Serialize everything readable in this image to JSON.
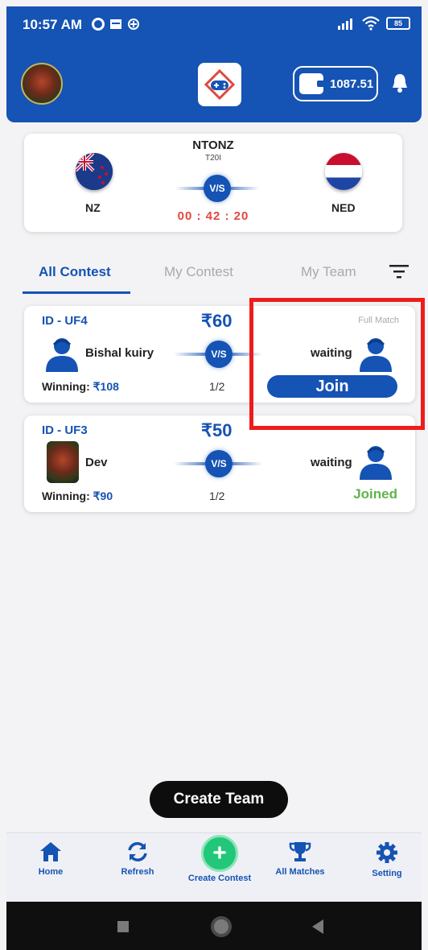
{
  "status_bar": {
    "time": "10:57 AM",
    "battery": "85"
  },
  "header": {
    "wallet_amount": "1087.51"
  },
  "match": {
    "title": "NTONZ",
    "format": "T20I",
    "team_left": "NZ",
    "team_right": "NED",
    "vs_label": "V/S",
    "countdown": "00 : 42 : 20"
  },
  "tabs": [
    {
      "label": "All Contest",
      "active": true
    },
    {
      "label": "My Contest",
      "active": false
    },
    {
      "label": "My Team",
      "active": false
    }
  ],
  "contests": [
    {
      "id": "ID - UF4",
      "fee": "₹60",
      "tag": "Full Match",
      "player": "Bishal kuiry",
      "vs_label": "V/S",
      "opponent": "waiting",
      "winning_label": "Winning:",
      "winning_value": "₹108",
      "slots": "1/2",
      "action": "Join"
    },
    {
      "id": "ID - UF3",
      "fee": "₹50",
      "player": "Dev",
      "vs_label": "V/S",
      "opponent": "waiting",
      "winning_label": "Winning:",
      "winning_value": "₹90",
      "slots": "1/2",
      "status": "Joined"
    }
  ],
  "create_team_label": "Create Team",
  "bottom_nav": [
    {
      "label": "Home",
      "icon": "home-icon"
    },
    {
      "label": "Refresh",
      "icon": "refresh-icon"
    },
    {
      "label": "Create Contest",
      "icon": "plus-icon"
    },
    {
      "label": "All Matches",
      "icon": "trophy-icon"
    },
    {
      "label": "Setting",
      "icon": "gear-icon"
    }
  ],
  "colors": {
    "primary": "#1553b4",
    "timer": "#e0483e",
    "joined": "#5fb34a",
    "highlight": "#ee1c1c",
    "create_contest": "#22c77a"
  }
}
